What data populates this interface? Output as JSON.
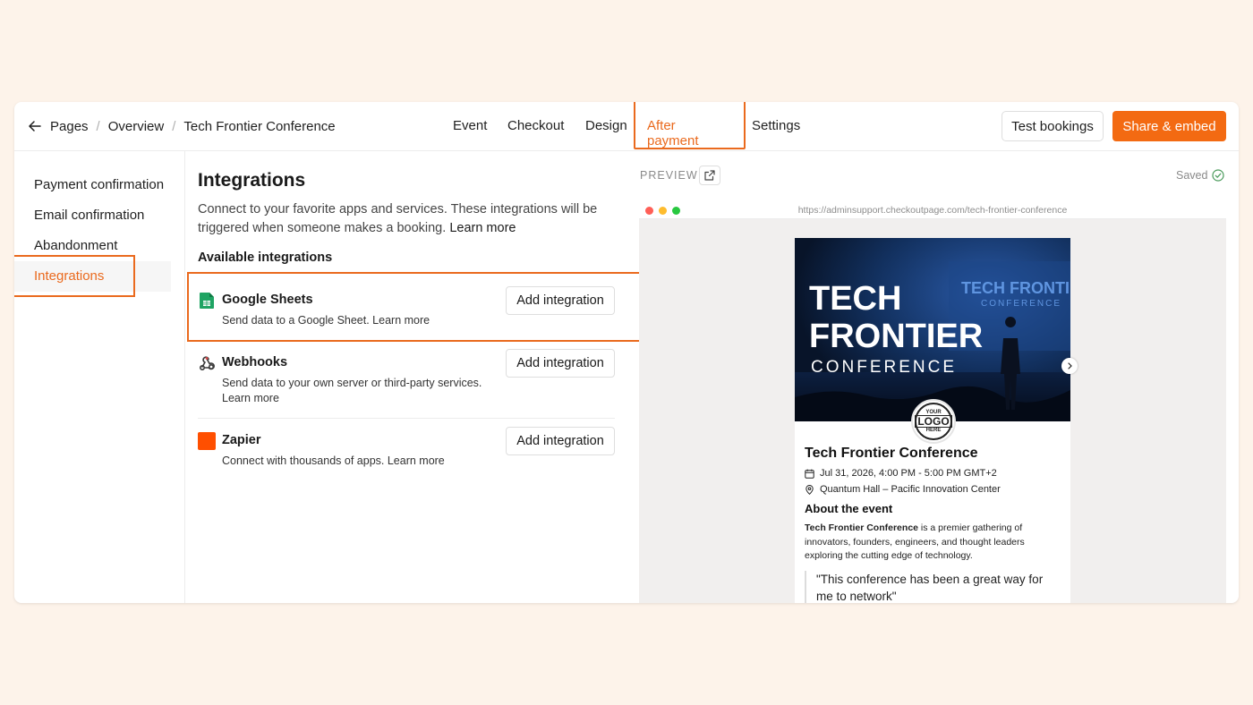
{
  "breadcrumb": {
    "items": [
      "Pages",
      "Overview",
      "Tech Frontier Conference"
    ],
    "separator": "/"
  },
  "tabs": [
    {
      "label": "Event"
    },
    {
      "label": "Checkout"
    },
    {
      "label": "Design"
    },
    {
      "label": "After payment",
      "active": true
    },
    {
      "label": "Settings"
    }
  ],
  "actions": {
    "test_label": "Test bookings",
    "share_label": "Share & embed"
  },
  "sidebar": {
    "items": [
      {
        "label": "Payment confirmation"
      },
      {
        "label": "Email confirmation"
      },
      {
        "label": "Abandonment"
      },
      {
        "label": "Integrations",
        "active": true
      }
    ]
  },
  "main": {
    "title": "Integrations",
    "description": "Connect to your favorite apps and services. These integrations will be triggered when someone makes a booking.",
    "learn_more": "Learn more",
    "available_heading": "Available integrations",
    "integrations": [
      {
        "name": "Google Sheets",
        "description": "Send data to a Google Sheet. Learn more",
        "button": "Add integration",
        "icon": "google-sheets-icon"
      },
      {
        "name": "Webhooks",
        "description": "Send data to your own server or third-party services. Learn more",
        "button": "Add integration",
        "icon": "webhook-icon"
      },
      {
        "name": "Zapier",
        "description": "Connect with thousands of apps. Learn more",
        "button": "Add integration",
        "icon": "zapier-icon"
      }
    ]
  },
  "preview": {
    "label": "PREVIEW",
    "saved_label": "Saved",
    "url": "https://adminsupport.checkoutpage.com/tech-frontier-conference",
    "hero": {
      "title_line1": "TECH",
      "title_line2": "FRONTIER",
      "title_line3": "CONFERENCE",
      "screen_line1": "TECH FRONTIER",
      "screen_line2": "CONFERENCE"
    },
    "logo": {
      "line1": "YOUR",
      "line2": "LOGO",
      "line3": "HERE"
    },
    "event_title": "Tech Frontier Conference",
    "date": "Jul 31, 2026, 4:00 PM - 5:00 PM GMT+2",
    "location": "Quantum Hall – Pacific Innovation Center",
    "about_heading": "About the event",
    "about_bold": "Tech Frontier Conference",
    "about_rest": " is a premier gathering of innovators, founders, engineers, and thought leaders exploring the cutting edge of technology.",
    "quote": "\"This conference has been a great way for me to network\""
  },
  "colors": {
    "accent": "#f36a12",
    "accent_text": "#ea6a1e",
    "background": "#fdf3ea",
    "sheets_green": "#1fa463",
    "zapier_orange": "#ff4f00"
  }
}
